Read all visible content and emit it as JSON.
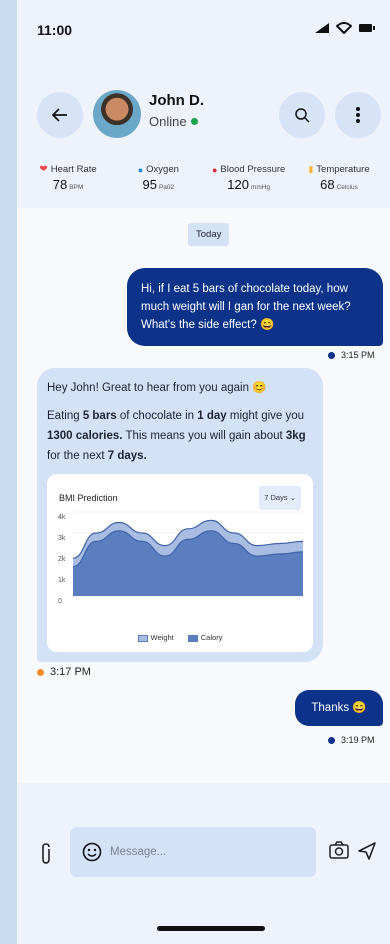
{
  "status_bar": {
    "time": "11:00"
  },
  "header": {
    "contact_name": "John D.",
    "status": "Online",
    "status_color": "#16a34a"
  },
  "vitals": [
    {
      "label": "Heart Rate",
      "value": "78",
      "unit": "BPM",
      "icon": "heart-icon",
      "color": "#e5484d"
    },
    {
      "label": "Oxygen",
      "value": "95",
      "unit": "Pa02",
      "icon": "drop-icon",
      "color": "#1e88e5"
    },
    {
      "label": "Blood Pressure",
      "value": "120",
      "unit": "mmHg",
      "icon": "drop-icon",
      "color": "#d32f2f"
    },
    {
      "label": "Temperature",
      "value": "68",
      "unit": "Celcius",
      "icon": "thermometer-icon",
      "color": "#f5b73b"
    }
  ],
  "chat": {
    "date_divider": "Today",
    "messages": [
      {
        "from": "me",
        "text": "Hi, if I eat 5 bars of chocolate today, how much weight will I gan for the next week? What's the side effect? 😄",
        "time": "3:15 PM"
      },
      {
        "from": "them",
        "greeting": "Hey John! Great to hear from you again 😊",
        "body": {
          "t1": "Eating ",
          "b1": "5 bars",
          "t2": " of chocolate in ",
          "b2": "1 day",
          "t3": " might give you ",
          "b3": "1300 calories.",
          "t4": " This means you will gain about ",
          "b4": "3kg",
          "t5": " for the next ",
          "b5": "7 days."
        },
        "time": "3:17 PM"
      },
      {
        "from": "me",
        "text": "Thanks 😄",
        "time": "3:19 PM"
      }
    ]
  },
  "chart_data": {
    "type": "area",
    "title": "BMI Prediction",
    "range_selector": "7 Days",
    "y_ticks": [
      "4k",
      "3k",
      "2k",
      "1k",
      "0"
    ],
    "ylim": [
      0,
      4000
    ],
    "x": [
      0,
      1,
      2,
      3,
      4,
      5,
      6,
      7,
      8,
      9,
      10
    ],
    "series": [
      {
        "name": "Weight",
        "color": "#a9bde3",
        "values": [
          1800,
          3000,
          3500,
          3000,
          2400,
          3200,
          3600,
          3000,
          2400,
          2500,
          2600
        ]
      },
      {
        "name": "Calory",
        "color": "#5b7ec1",
        "values": [
          1400,
          2600,
          3100,
          2600,
          1900,
          2700,
          3100,
          2500,
          1900,
          2000,
          2100
        ]
      }
    ],
    "grid": true,
    "legend": "bottom"
  },
  "input": {
    "placeholder": "Message..."
  },
  "colors": {
    "outgoing_bubble": "#0c3389",
    "incoming_bubble": "#d4e2f7",
    "accent": "#0c3389"
  }
}
